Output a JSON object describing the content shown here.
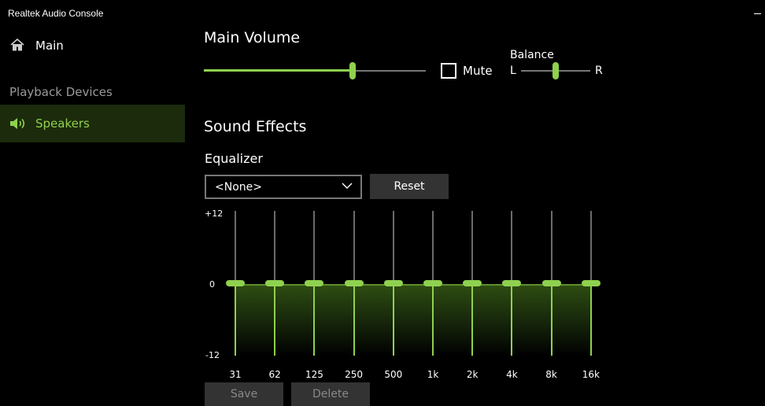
{
  "window": {
    "title": "Realtek Audio Console"
  },
  "sidebar": {
    "main_label": "Main",
    "section_label": "Playback Devices",
    "device_label": "Speakers"
  },
  "volume": {
    "heading": "Main Volume",
    "level_percent": 67,
    "mute_label": "Mute",
    "muted": false,
    "balance_label": "Balance",
    "balance_left": "L",
    "balance_right": "R",
    "balance_position": 0.5
  },
  "effects": {
    "heading": "Sound Effects",
    "equalizer_label": "Equalizer",
    "preset_value": "<None>",
    "reset_label": "Reset",
    "scale_top": "+12",
    "scale_mid": "0",
    "scale_bottom": "-12",
    "bands": [
      {
        "freq": "31",
        "gain": 0
      },
      {
        "freq": "62",
        "gain": 0
      },
      {
        "freq": "125",
        "gain": 0
      },
      {
        "freq": "250",
        "gain": 0
      },
      {
        "freq": "500",
        "gain": 0
      },
      {
        "freq": "1k",
        "gain": 0
      },
      {
        "freq": "2k",
        "gain": 0
      },
      {
        "freq": "4k",
        "gain": 0
      },
      {
        "freq": "8k",
        "gain": 0
      },
      {
        "freq": "16k",
        "gain": 0
      }
    ],
    "save_label": "Save",
    "delete_label": "Delete"
  },
  "colors": {
    "accent": "#8fd14f",
    "selected_bg": "#1c2b0c",
    "button_bg": "#333333"
  }
}
